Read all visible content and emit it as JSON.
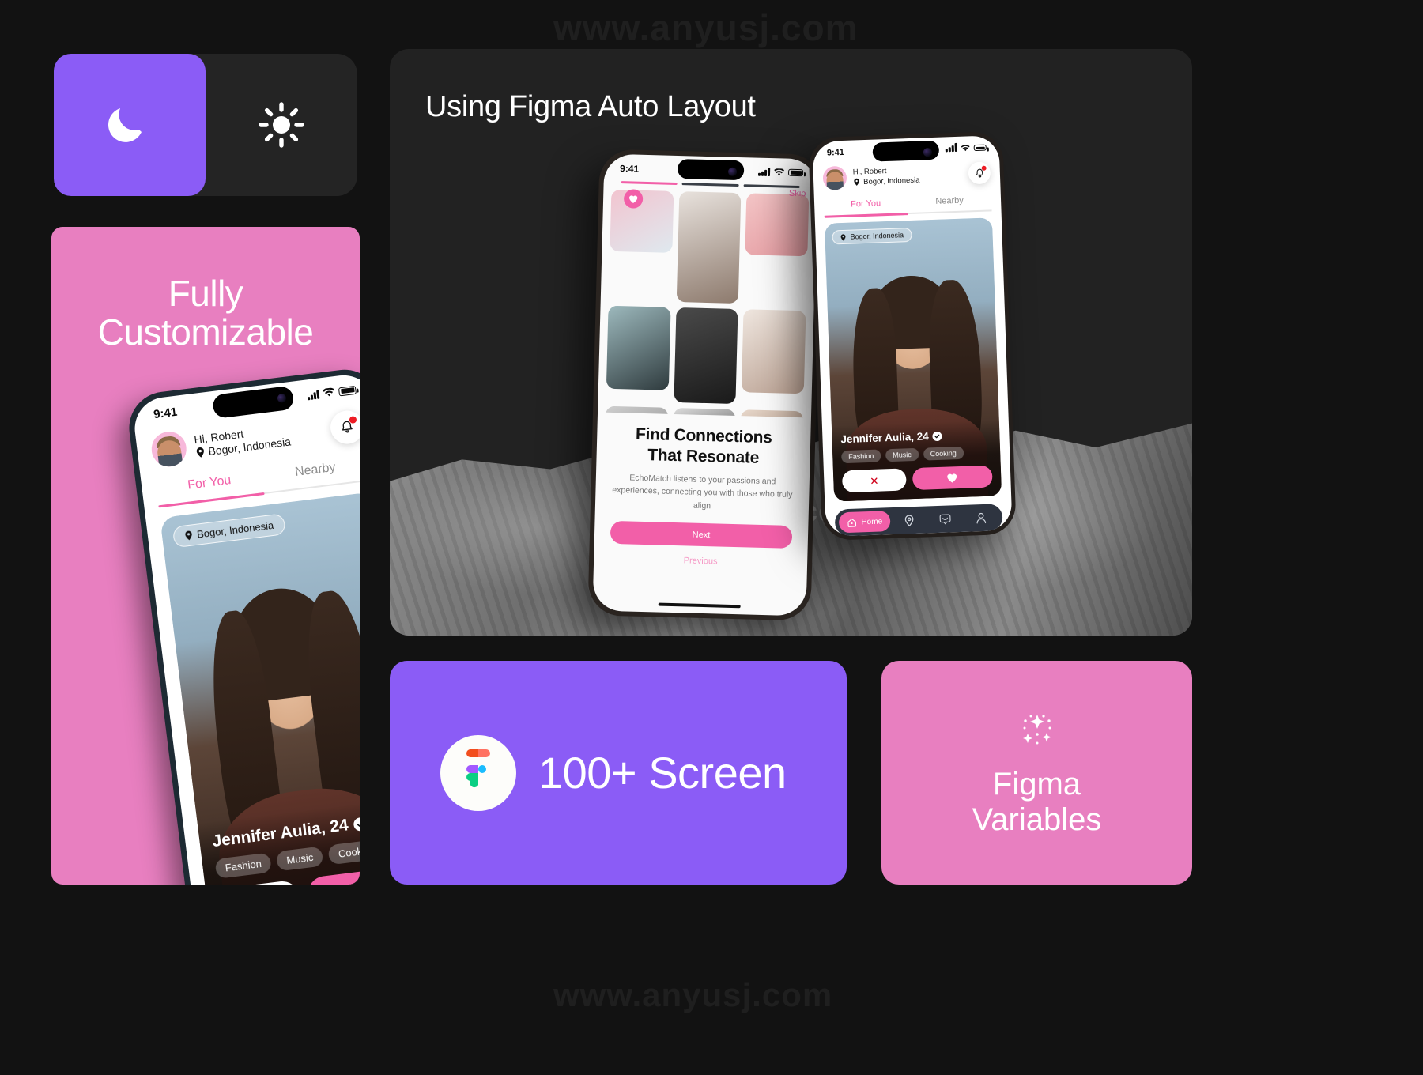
{
  "watermarks": {
    "top": "www.anyusj.com",
    "middle": "www.anyusj.com",
    "bottom": "www.anyusj.com"
  },
  "theme_toggle": {
    "dark_icon": "moon-icon",
    "light_icon": "sun-icon",
    "active": "dark",
    "active_color": "#8B5CF6",
    "card_bg": "#242424"
  },
  "pink_panel": {
    "title_line1": "Fully",
    "title_line2": "Customizable",
    "bg": "#E87FC0"
  },
  "showcase": {
    "title": "Using Figma Auto Layout",
    "bg": "#222222"
  },
  "phone_app": {
    "status": {
      "time": "9:41",
      "signal_icon": "cellular-bars-icon",
      "wifi_icon": "wifi-icon",
      "battery_icon": "battery-icon"
    },
    "header": {
      "greeting": "Hi, Robert",
      "location": "Bogor, Indonesia",
      "location_icon": "map-pin-icon",
      "bell_icon": "bell-icon",
      "avatar": "user-avatar"
    },
    "tabs": [
      {
        "label": "For You",
        "active": true
      },
      {
        "label": "Nearby",
        "active": false
      }
    ],
    "card": {
      "location_chip": "Bogor, Indonesia",
      "name": "Jennifer Aulia, 24",
      "verified_icon": "verified-check-icon",
      "chips": [
        "Fashion",
        "Music",
        "Cooking"
      ],
      "pass_icon": "close-x-icon",
      "like_icon": "heart-icon"
    },
    "tabbar": [
      {
        "label": "Home",
        "icon": "home-icon",
        "active": true
      },
      {
        "label": "",
        "icon": "map-pin-icon",
        "active": false
      },
      {
        "label": "",
        "icon": "chat-icon",
        "active": false
      },
      {
        "label": "",
        "icon": "profile-icon",
        "active": false
      }
    ],
    "accent": "#F25FA8"
  },
  "onboarding_phone": {
    "status_time": "9:41",
    "skip_label": "Skip",
    "heading_line1": "Find Connections",
    "heading_line2": "That Resonate",
    "body": "EchoMatch listens to your passions and experiences, connecting you with those who truly align",
    "next_label": "Next",
    "previous_label": "Previous",
    "progress_steps": 3,
    "progress_active": 1
  },
  "purple_card": {
    "label": "100+ Screen",
    "icon": "figma-logo-icon",
    "bg": "#8B5CF6"
  },
  "variables_card": {
    "label_line1": "Figma",
    "label_line2": "Variables",
    "icon": "sparkles-icon",
    "bg": "#E87FC0"
  }
}
